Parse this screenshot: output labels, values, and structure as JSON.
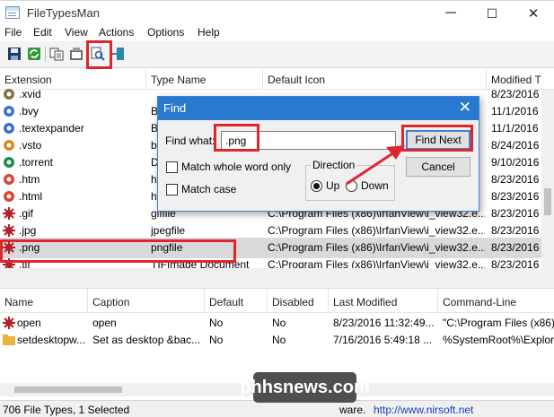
{
  "window": {
    "title": "FileTypesMan",
    "controls": {
      "minimize": "─",
      "maximize": "☐",
      "close": "✕"
    }
  },
  "menu": [
    "File",
    "Edit",
    "View",
    "Actions",
    "Options",
    "Help"
  ],
  "toolbar": {
    "buttons": [
      "save-icon",
      "refresh-icon",
      "copy-icon",
      "properties-icon",
      "find-icon",
      "exit-icon"
    ]
  },
  "upper_list": {
    "columns": [
      "Extension",
      "Type Name",
      "Default Icon",
      "Modified T"
    ],
    "rows": [
      {
        "ext": ".xvid",
        "type": "",
        "icon": "",
        "modified": "8/23/2016",
        "icon_color": "#8a6f4a",
        "selected": false
      },
      {
        "ext": ".bvy",
        "type": "B",
        "icon": "",
        "modified": "11/1/2016",
        "icon_color": "#3a6fd2",
        "selected": false
      },
      {
        "ext": ".textexpander",
        "type": "B",
        "icon": "",
        "modified": "11/1/2016",
        "icon_color": "#3a6fd2",
        "selected": false
      },
      {
        "ext": ".vsto",
        "type": "b",
        "icon": "",
        "modified": "8/24/2016",
        "icon_color": "#d88a1e",
        "selected": false
      },
      {
        "ext": ".torrent",
        "type": "D",
        "icon": "",
        "modified": "9/10/2016",
        "icon_color": "#1f8a50",
        "selected": false
      },
      {
        "ext": ".htm",
        "type": "ht",
        "icon": "",
        "modified": "8/23/2016",
        "icon_color": "#db4437",
        "selected": false
      },
      {
        "ext": ".html",
        "type": "ht",
        "icon": "",
        "modified": "8/23/2016",
        "icon_color": "#db4437",
        "selected": false
      },
      {
        "ext": ".gif",
        "type": "giffile",
        "icon": "C:\\Program Files (x86)\\IrfanView\\i_view32.e...",
        "modified": "8/23/2016",
        "icon_color": "#b3202a",
        "selected": false
      },
      {
        "ext": ".jpg",
        "type": "jpegfile",
        "icon": "C:\\Program Files (x86)\\IrfanView\\i_view32.e...",
        "modified": "8/23/2016",
        "icon_color": "#b3202a",
        "selected": false
      },
      {
        "ext": ".png",
        "type": "pngfile",
        "icon": "C:\\Program Files (x86)\\IrfanView\\i_view32.e...",
        "modified": "8/23/2016",
        "icon_color": "#b3202a",
        "selected": true
      },
      {
        "ext": ".tif",
        "type": "TIFImage Document",
        "icon": "C:\\Program Files (x86)\\IrfanView\\i_view32.e...",
        "modified": "8/23/2016",
        "icon_color": "#b3202a",
        "selected": false
      }
    ]
  },
  "lower_list": {
    "columns": [
      "Name",
      "Caption",
      "Default",
      "Disabled",
      "Last Modified",
      "Command-Line"
    ],
    "rows": [
      {
        "name": "open",
        "caption": "open",
        "default": "No",
        "disabled": "No",
        "modified": "8/23/2016 11:32:49...",
        "cmd": "\"C:\\Program Files (x86)\\",
        "icon_color": "#b3202a"
      },
      {
        "name": "setdesktopw...",
        "caption": "Set as desktop &bac...",
        "default": "No",
        "disabled": "No",
        "modified": "7/16/2016 5:49:18 ...",
        "cmd": "%SystemRoot%\\Explore",
        "icon_color": "#e8b43a"
      }
    ]
  },
  "status": {
    "count": "706 File Types, 1 Selected",
    "credit_prefix": "ware.",
    "credit_link": "http://www.nirsoft.net"
  },
  "find_dialog": {
    "title": "Find",
    "find_what_label": "Find what:",
    "find_what_value": ".png",
    "whole_word_label": "Match whole word only",
    "match_case_label": "Match case",
    "direction_label": "Direction",
    "up_label": "Up",
    "down_label": "Down",
    "direction_selected": "Up",
    "find_next_label": "Find Next",
    "cancel_label": "Cancel"
  },
  "watermark": "phhsnews.com",
  "colors": {
    "highlight": "#e0252e",
    "dialog_title": "#2a79d0",
    "selection": "#d9d9d9",
    "link": "#1a3fb8"
  }
}
